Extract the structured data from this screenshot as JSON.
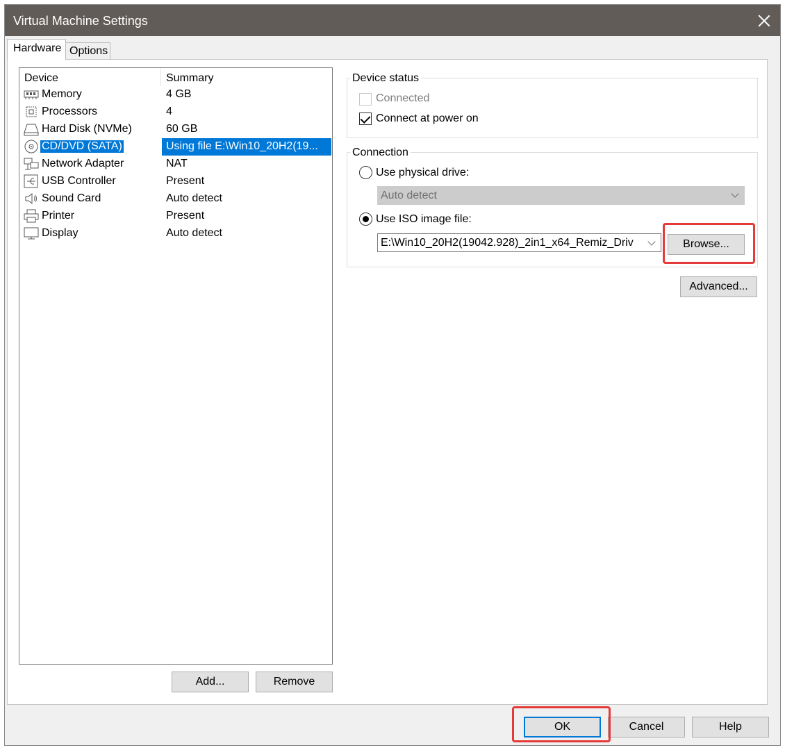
{
  "window": {
    "title": "Virtual Machine Settings"
  },
  "tabs": [
    {
      "label": "Hardware"
    },
    {
      "label": "Options"
    }
  ],
  "device_list": {
    "columns": {
      "device": "Device",
      "summary": "Summary"
    },
    "rows": [
      {
        "name": "Memory",
        "summary": "4 GB",
        "icon": "memory-icon"
      },
      {
        "name": "Processors",
        "summary": "4",
        "icon": "processor-icon"
      },
      {
        "name": "Hard Disk (NVMe)",
        "summary": "60 GB",
        "icon": "hard-disk-icon"
      },
      {
        "name": "CD/DVD (SATA)",
        "summary": "Using file E:\\Win10_20H2(19...",
        "icon": "cd-dvd-icon",
        "selected": true
      },
      {
        "name": "Network Adapter",
        "summary": "NAT",
        "icon": "network-adapter-icon"
      },
      {
        "name": "USB Controller",
        "summary": "Present",
        "icon": "usb-icon"
      },
      {
        "name": "Sound Card",
        "summary": "Auto detect",
        "icon": "speaker-icon"
      },
      {
        "name": "Printer",
        "summary": "Present",
        "icon": "printer-icon"
      },
      {
        "name": "Display",
        "summary": "Auto detect",
        "icon": "monitor-icon"
      }
    ]
  },
  "buttons": {
    "add": "Add...",
    "remove": "Remove",
    "browse": "Browse...",
    "advanced": "Advanced...",
    "ok": "OK",
    "cancel": "Cancel",
    "help": "Help"
  },
  "device_status": {
    "title": "Device status",
    "connected_label": "Connected",
    "connected_checked": false,
    "connected_enabled": false,
    "connect_at_power_on_label": "Connect at power on",
    "connect_at_power_on_checked": true
  },
  "connection": {
    "title": "Connection",
    "physical_label": "Use physical drive:",
    "physical_selected": false,
    "physical_value": "Auto detect",
    "iso_label": "Use ISO image file:",
    "iso_selected": true,
    "iso_path": "E:\\Win10_20H2(19042.928)_2in1_x64_Remiz_Driv"
  },
  "colors": {
    "selection": "#0078d7",
    "titlebar": "#625c58",
    "highlight_box": "#e53a3a"
  }
}
